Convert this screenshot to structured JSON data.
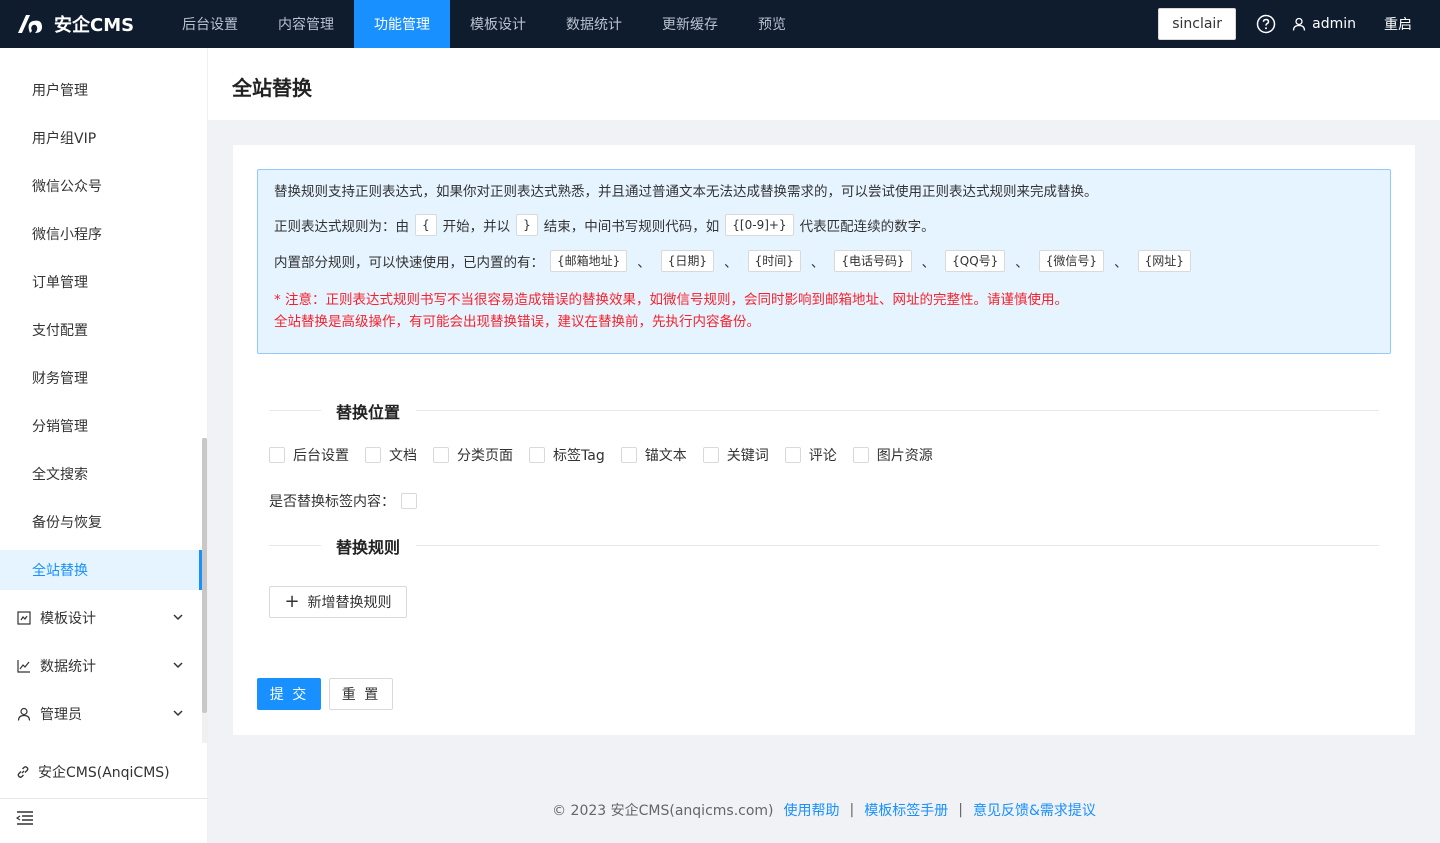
{
  "brand": {
    "name": "安企CMS"
  },
  "nav": {
    "items": [
      {
        "label": "后台设置"
      },
      {
        "label": "内容管理"
      },
      {
        "label": "功能管理",
        "active": true
      },
      {
        "label": "模板设计"
      },
      {
        "label": "数据统计"
      },
      {
        "label": "更新缓存"
      },
      {
        "label": "预览"
      }
    ]
  },
  "topright": {
    "site_button": "sinclair",
    "username": "admin",
    "restart": "重启"
  },
  "sidebar": {
    "sub_items": [
      {
        "label": "用户管理"
      },
      {
        "label": "用户组VIP"
      },
      {
        "label": "微信公众号"
      },
      {
        "label": "微信小程序"
      },
      {
        "label": "订单管理"
      },
      {
        "label": "支付配置"
      },
      {
        "label": "财务管理"
      },
      {
        "label": "分销管理"
      },
      {
        "label": "全文搜索"
      },
      {
        "label": "备份与恢复"
      },
      {
        "label": "全站替换",
        "active": true
      }
    ],
    "groups": [
      {
        "label": "模板设计",
        "icon": "template-icon"
      },
      {
        "label": "数据统计",
        "icon": "chart-icon"
      },
      {
        "label": "管理员",
        "icon": "user-icon"
      }
    ],
    "footer_link": "安企CMS(AnqiCMS)"
  },
  "page": {
    "title": "全站替换"
  },
  "notice": {
    "line1": "替换规则支持正则表达式，如果你对正则表达式熟悉，并且通过普通文本无法达成替换需求的，可以尝试使用正则表达式规则来完成替换。",
    "line2_a": "正则表达式规则为：由",
    "line2_chip1": "{",
    "line2_b": "开始，并以",
    "line2_chip2": "}",
    "line2_c": "结束，中间书写规则代码，如",
    "line2_chip3": "{[0-9]+}",
    "line2_d": "代表匹配连续的数字。",
    "line3_a": "内置部分规则，可以快速使用，已内置的有：",
    "builtin_rules": [
      "{邮箱地址}",
      "{日期}",
      "{时间}",
      "{电话号码}",
      "{QQ号}",
      "{微信号}",
      "{网址}"
    ],
    "separator": "、",
    "warn1": "* 注意：正则表达式规则书写不当很容易造成错误的替换效果，如微信号规则，会同时影响到邮箱地址、网址的完整性。请谨慎使用。",
    "warn2": "全站替换是高级操作，有可能会出现替换错误，建议在替换前，先执行内容备份。"
  },
  "section_position": {
    "title": "替换位置"
  },
  "positions": [
    "后台设置",
    "文档",
    "分类页面",
    "标签Tag",
    "锚文本",
    "关键词",
    "评论",
    "图片资源"
  ],
  "tag_replace_label": "是否替换标签内容：",
  "section_rules": {
    "title": "替换规则"
  },
  "add_rule_label": "新增替换规则",
  "submit_label": "提 交",
  "reset_label": "重 置",
  "footer": {
    "copyright": "© 2023 安企CMS(anqicms.com)",
    "link1": "使用帮助",
    "link2": "模板标签手册",
    "link3": "意见反馈&需求提议",
    "separator": "|"
  },
  "colors": {
    "topbar": "#0f1c2e",
    "primary": "#1890ff",
    "warn": "#f5222d",
    "notice_bg": "#e6f4ff"
  }
}
